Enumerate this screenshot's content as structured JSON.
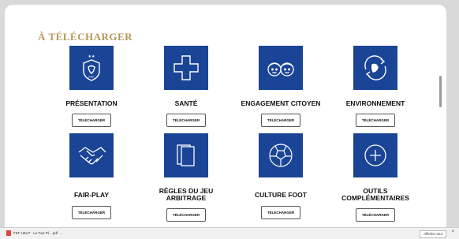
{
  "heading": "À TÉLÉCHARGER",
  "download_label": "TÉLÉCHARGER",
  "cards": [
    {
      "title": "PRÉSENTATION",
      "icon": "fff-logo-icon"
    },
    {
      "title": "SANTÉ",
      "icon": "cross-icon"
    },
    {
      "title": "ENGAGEMENT CITOYEN",
      "icon": "faces-icon"
    },
    {
      "title": "ENVIRONNEMENT",
      "icon": "rooster-cycle-icon"
    },
    {
      "title": "FAIR-PLAY",
      "icon": "handshake-icon"
    },
    {
      "title": "RÈGLES DU JEU ARBITRAGE",
      "icon": "cards-icon"
    },
    {
      "title": "CULTURE FOOT",
      "icon": "football-icon"
    },
    {
      "title": "OUTILS COMPLÉMENTAIRES",
      "icon": "plus-circle-icon"
    }
  ],
  "statusbar": {
    "file": "FEF U6U7 - Le Fair-Pl....pdf",
    "more": "...",
    "show_all": "Afficher tout",
    "close": "×"
  },
  "colors": {
    "tile": "#1a4496",
    "heading": "#b5985a"
  }
}
